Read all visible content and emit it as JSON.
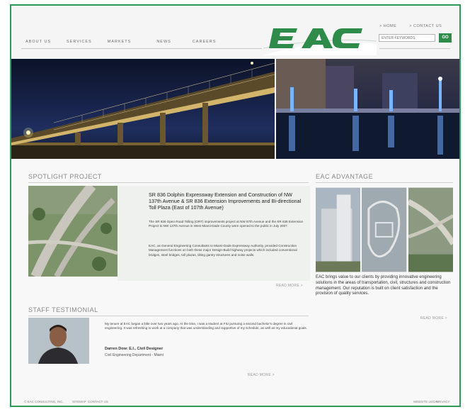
{
  "nav": [
    "ABOUT US",
    "SERVICES",
    "MARKETS",
    "NEWS",
    "CAREERS"
  ],
  "logo_text": "EAC",
  "top_links": [
    "> HOME",
    "> CONTACT US"
  ],
  "search": {
    "placeholder": "ENTER KEYWORDS",
    "button": "GO"
  },
  "spotlight": {
    "heading": "SPOTLIGHT PROJECT",
    "title": "SR 836 Dolphin Expressway Extension and Construction of NW 137th Avenue & SR 836 Extension Improvements and Bi-directional Toll Plaza (East of 107th Avenue)",
    "para1": "The SR 836 Open Road Tolling (ORT) improvements project at NW 87th Avenue and the SR 836 Extension Project to NW 137th Avenue in West Miami-Dade County were opened to the public in July 2007.",
    "para2": "EAC, as General Engineering Consultants to Miami-Dade Expressway Authority, provided Construction Management functions on both these major Design-Build highway projects which included conventional bridges, steel bridges, toll plazas, tilting gantry structures and noise walls.",
    "readmore": "READ MORE >"
  },
  "testimonial": {
    "heading": "STAFF TESTIMONIAL",
    "quote": "My tenure at EAC began a little over two years ago. At the time, I was a student at FIU pursuing a second bachelor's degree in civil engineering. It was refreshing to work at a company that was understanding and supportive of my schedule, as well as my educational goals.",
    "name": "Darren Dow: E.I., Civil Designer",
    "dept": "Civil Engineering Department - Miami",
    "readmore": "READ MORE >"
  },
  "advantage": {
    "heading": "EAC ADVANTAGE",
    "text": "EAC brings value to our clients by providing innovative engineering solutions in the areas of transportation, civil, structures and construction management. Our reputation is built on client satisfaction and the provision of quality services.",
    "readmore": "READ MORE >"
  },
  "footer": {
    "left": [
      "© EAC CONSULTING, INC.",
      "SITEMAP",
      "CONTACT US"
    ],
    "right": [
      "WEBSITE LEGAL",
      "PRIVACY"
    ]
  },
  "colors": {
    "accent": "#2e8b4a",
    "border": "#2e9a5a"
  }
}
